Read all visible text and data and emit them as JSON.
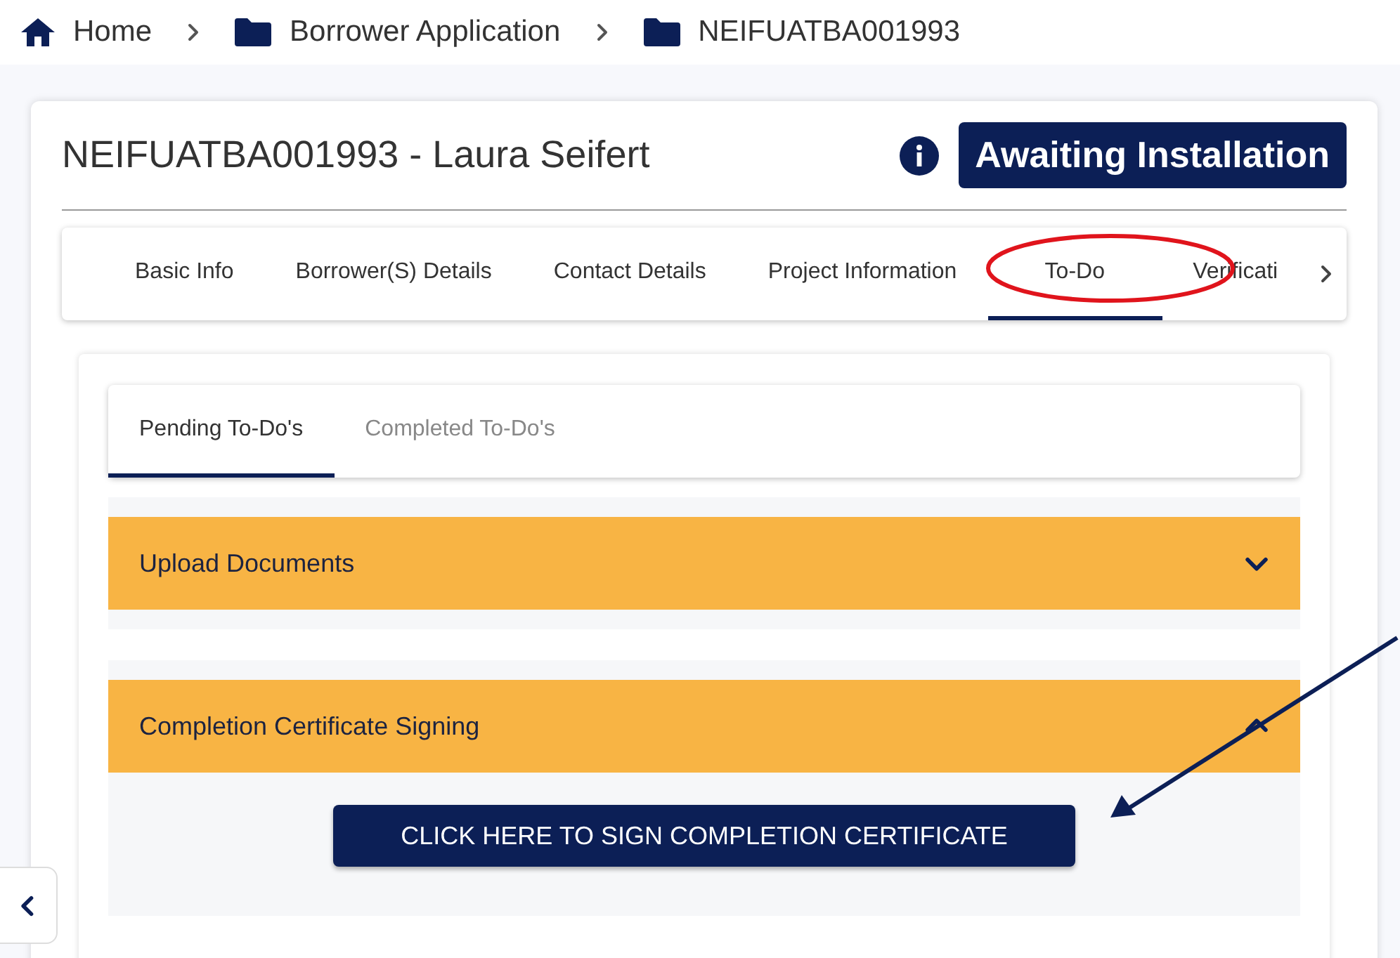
{
  "breadcrumb": [
    {
      "label": "Home",
      "kind": "home"
    },
    {
      "label": "Borrower Application",
      "kind": "folder"
    },
    {
      "label": "NEIFUATBA001993",
      "kind": "folder"
    }
  ],
  "header": {
    "title": "NEIFUATBA001993 - Laura Seifert",
    "status": "Awaiting Installation"
  },
  "tabs": [
    {
      "label": "Basic Info",
      "selected": false
    },
    {
      "label": "Borrower(S) Details",
      "selected": false
    },
    {
      "label": "Contact Details",
      "selected": false
    },
    {
      "label": "Project Information",
      "selected": false
    },
    {
      "label": "To-Do",
      "selected": true
    },
    {
      "label": "Verificati",
      "selected": false
    }
  ],
  "subtabs": [
    {
      "label": "Pending To-Do's",
      "selected": true
    },
    {
      "label": "Completed To-Do's",
      "selected": false
    }
  ],
  "accordions": [
    {
      "title": "Upload Documents",
      "expanded": false
    },
    {
      "title": "Completion Certificate Signing",
      "expanded": true,
      "button": "CLICK HERE TO SIGN COMPLETION CERTIFICATE"
    }
  ]
}
